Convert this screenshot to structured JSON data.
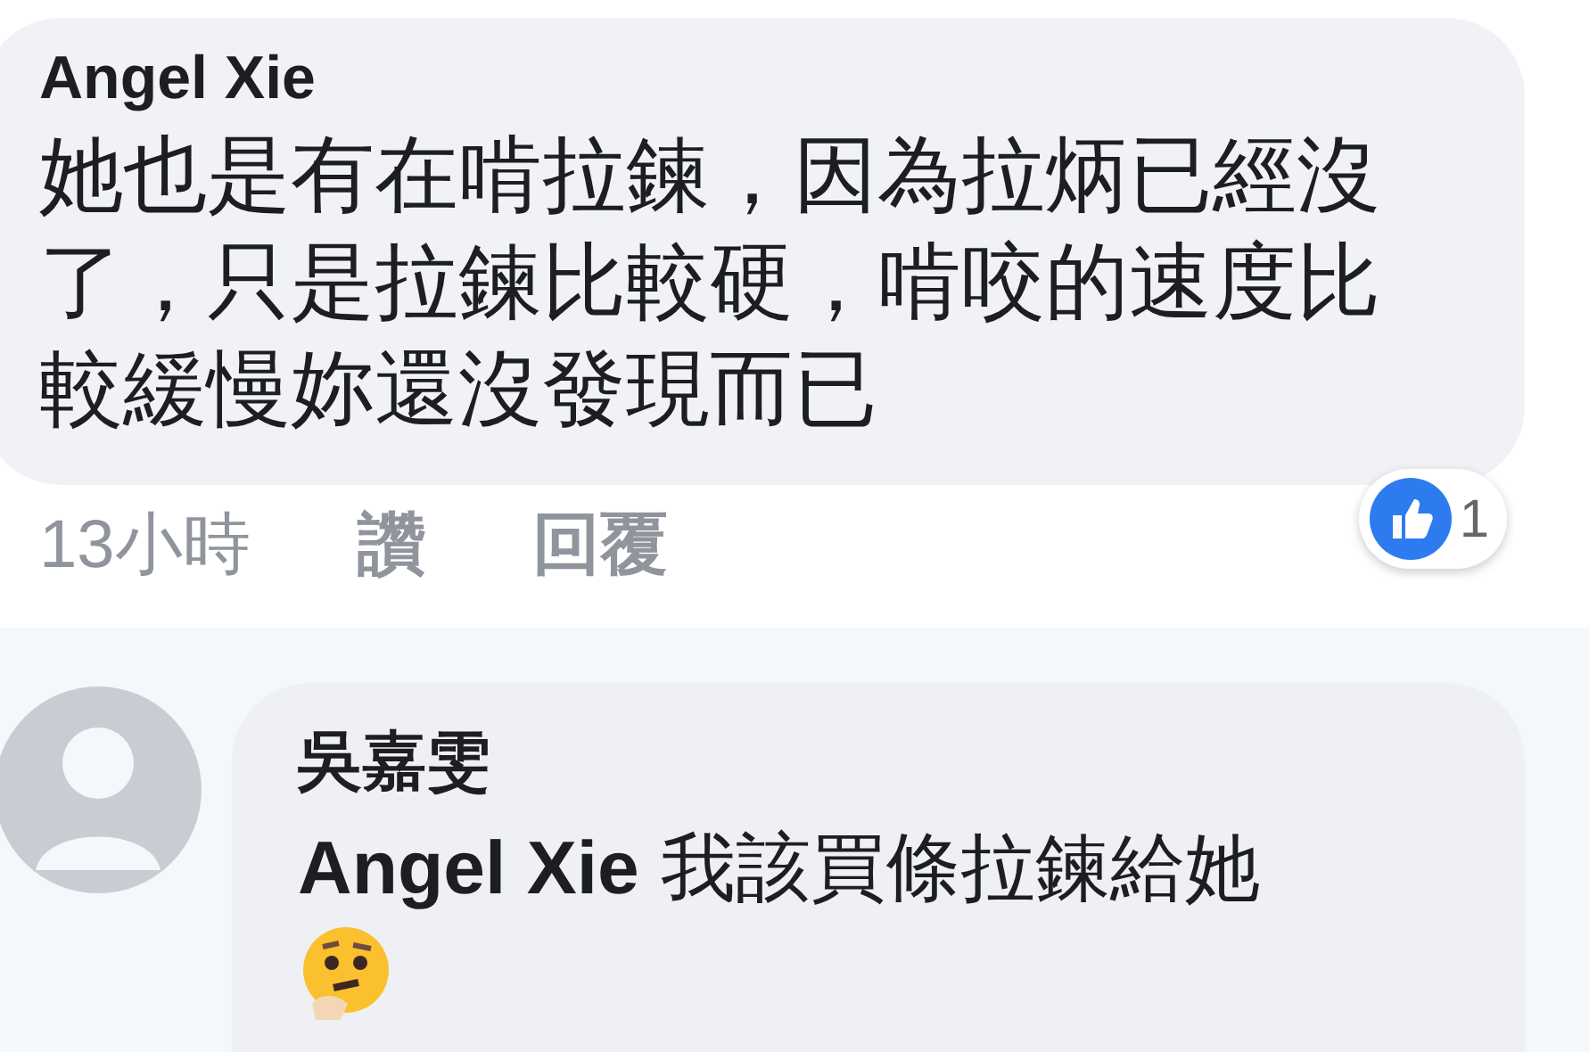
{
  "comment": {
    "author": "Angel Xie",
    "text": "她也是有在啃拉鍊，因為拉炳已經沒了，只是拉鍊比較硬，啃咬的速度比較緩慢妳還沒發現而已",
    "time": "13小時",
    "actions": [
      "讚",
      "回覆"
    ],
    "reaction_count": "1"
  },
  "reply": {
    "author": "吳嘉雯",
    "mention": "Angel Xie",
    "text": "我該買條拉鍊給她"
  }
}
